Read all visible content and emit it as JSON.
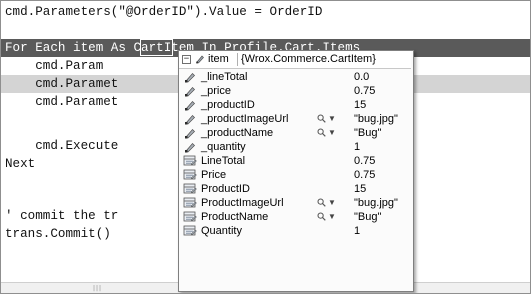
{
  "code": {
    "line1": "cmd.Parameters(\"@OrderID\").Value = OrderID",
    "line2": "For Each item As CartItem In Profile.Cart.Items",
    "line3": "    cmd.Param                      = item.Pr",
    "line4": "    cmd.Paramet                     item.Qua",
    "line5": "    cmd.Paramet                    em.Price",
    "line6": "    cmd.Execute",
    "line7": "Next",
    "line8": "' commit the tr",
    "line9": "trans.Commit()"
  },
  "datatip": {
    "collapse_glyph": "−",
    "variable": "item",
    "type": "{Wrox.Commerce.CartItem}",
    "rows": [
      {
        "name": "_lineTotal",
        "value": "0.0",
        "icon": "field-icon",
        "visualizer": false
      },
      {
        "name": "_price",
        "value": "0.75",
        "icon": "field-icon",
        "visualizer": false
      },
      {
        "name": "_productID",
        "value": "15",
        "icon": "field-icon",
        "visualizer": false
      },
      {
        "name": "_productImageUrl",
        "value": "\"bug.jpg\"",
        "icon": "field-icon",
        "visualizer": true
      },
      {
        "name": "_productName",
        "value": "\"Bug\"",
        "icon": "field-icon",
        "visualizer": true
      },
      {
        "name": "_quantity",
        "value": "1",
        "icon": "field-icon",
        "visualizer": false
      },
      {
        "name": "LineTotal",
        "value": "0.75",
        "icon": "property-icon",
        "visualizer": false
      },
      {
        "name": "Price",
        "value": "0.75",
        "icon": "property-icon",
        "visualizer": false
      },
      {
        "name": "ProductID",
        "value": "15",
        "icon": "property-icon",
        "visualizer": false
      },
      {
        "name": "ProductImageUrl",
        "value": "\"bug.jpg\"",
        "icon": "property-icon",
        "visualizer": true
      },
      {
        "name": "ProductName",
        "value": "\"Bug\"",
        "icon": "property-icon",
        "visualizer": true
      },
      {
        "name": "Quantity",
        "value": "1",
        "icon": "property-icon",
        "visualizer": false
      }
    ],
    "dropdown_glyph": "▼"
  },
  "scrollbar": {
    "grip": "|||"
  },
  "colors": {
    "highlight_current_line": "#5a5a5a",
    "highlight_breakpoint_line": "#d4d4d4",
    "datatip_background": "#fbfbfb"
  }
}
